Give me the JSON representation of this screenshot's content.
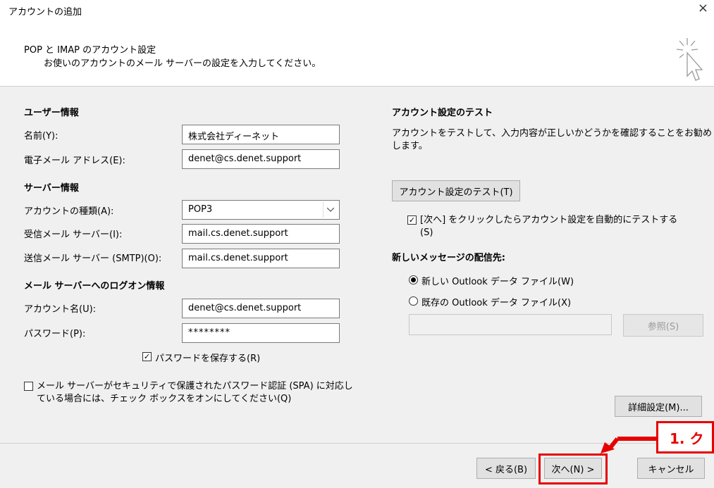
{
  "window": {
    "title": "アカウントの追加",
    "close_label": "×"
  },
  "header": {
    "title": "POP と IMAP のアカウント設定",
    "subtitle": "お使いのアカウントのメール サーバーの設定を入力してください。",
    "icon": "cursor-sparkle-icon"
  },
  "user_info": {
    "heading": "ユーザー情報",
    "name_label": "名前(Y):",
    "name_value": "株式会社ディーネット",
    "email_label": "電子メール アドレス(E):",
    "email_value": "denet@cs.denet.support"
  },
  "server_info": {
    "heading": "サーバー情報",
    "account_type_label": "アカウントの種類(A):",
    "account_type_value": "POP3",
    "incoming_label": "受信メール サーバー(I):",
    "incoming_value": "mail.cs.denet.support",
    "outgoing_label": "送信メール サーバー (SMTP)(O):",
    "outgoing_value": "mail.cs.denet.support"
  },
  "logon_info": {
    "heading": "メール サーバーへのログオン情報",
    "account_name_label": "アカウント名(U):",
    "account_name_value": "denet@cs.denet.support",
    "password_label": "パスワード(P):",
    "password_value": "********",
    "save_password_label": "パスワードを保存する(R)",
    "spa_label_line1": "メール サーバーがセキュリティで保護されたパスワード認証 (SPA) に対応し",
    "spa_label_line2": "ている場合には、チェック ボックスをオンにしてください(Q)"
  },
  "test": {
    "heading": "アカウント設定のテスト",
    "description_line1": "アカウントをテストして、入力内容が正しいかどうかを確認することをお勧め",
    "description_line2": "します。",
    "test_button": "アカウント設定のテスト(T)",
    "auto_test_line1": "[次へ] をクリックしたらアカウント設定を自動的にテストする",
    "auto_test_line2": "(S)"
  },
  "delivery": {
    "heading": "新しいメッセージの配信先:",
    "option_new": "新しい Outlook データ ファイル(W)",
    "option_existing": "既存の Outlook データ ファイル(X)",
    "browse_button": "参照(S)"
  },
  "advanced_button": "詳細設定(M)...",
  "footer": {
    "back_button": "< 戻る(B)",
    "next_button": "次へ(N) >",
    "cancel_button": "キャンセル"
  },
  "annotation": {
    "callout_text": "1. ク",
    "highlight_color": "#e60000"
  }
}
